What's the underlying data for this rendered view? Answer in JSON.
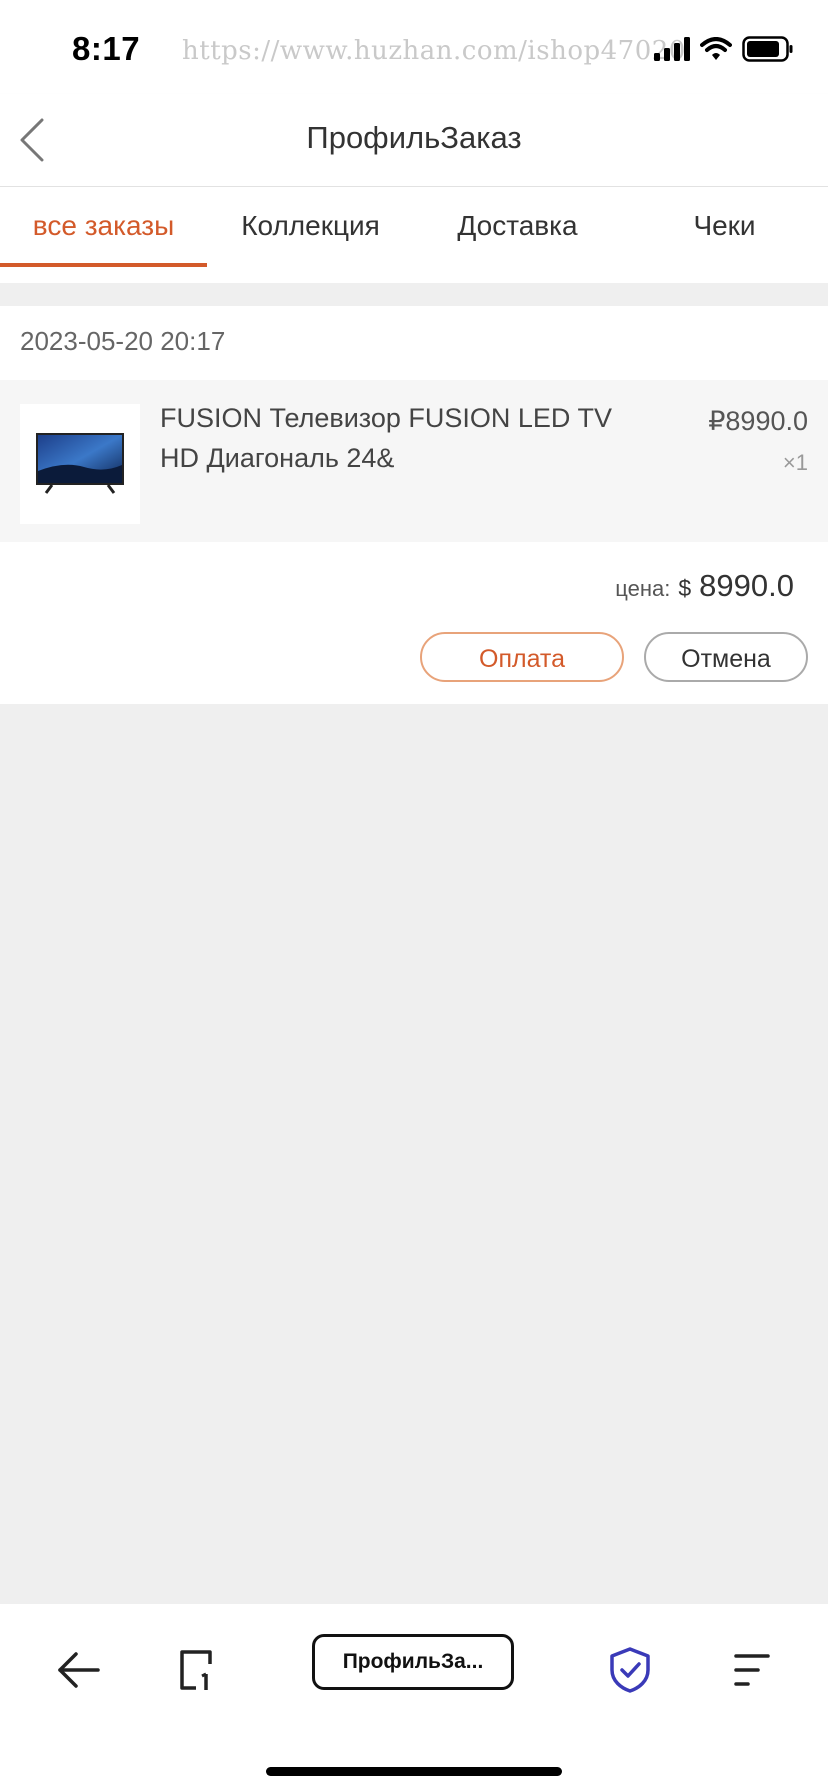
{
  "status_bar": {
    "time": "8:17",
    "watermark": "https://www.huzhan.com/ishop47020"
  },
  "header": {
    "title": "ПрофильЗаказ",
    "back_icon": "chevron-left-icon"
  },
  "tabs": [
    {
      "label": "все заказы",
      "active": true
    },
    {
      "label": "Коллекция",
      "active": false
    },
    {
      "label": "Доставка",
      "active": false
    },
    {
      "label": "Чеки",
      "active": false
    }
  ],
  "order": {
    "date": "2023-05-20 20:17",
    "item": {
      "name": "FUSION Телевизор FUSION LED TV HD Диагональ 24&",
      "price": "₽8990.0",
      "qty": "×1"
    },
    "total": {
      "label": "цена:",
      "currency": "$",
      "value": "8990.0"
    },
    "buttons": {
      "pay": "Оплата",
      "cancel": "Отмена"
    }
  },
  "browser_bar": {
    "url_label": "ПрофильЗа...",
    "icons": [
      "back-arrow-icon",
      "tabs-icon",
      "shield-check-icon",
      "menu-icon"
    ]
  },
  "colors": {
    "accent": "#d35a2a",
    "background": "#efefef",
    "shield": "#3a3ab8"
  }
}
